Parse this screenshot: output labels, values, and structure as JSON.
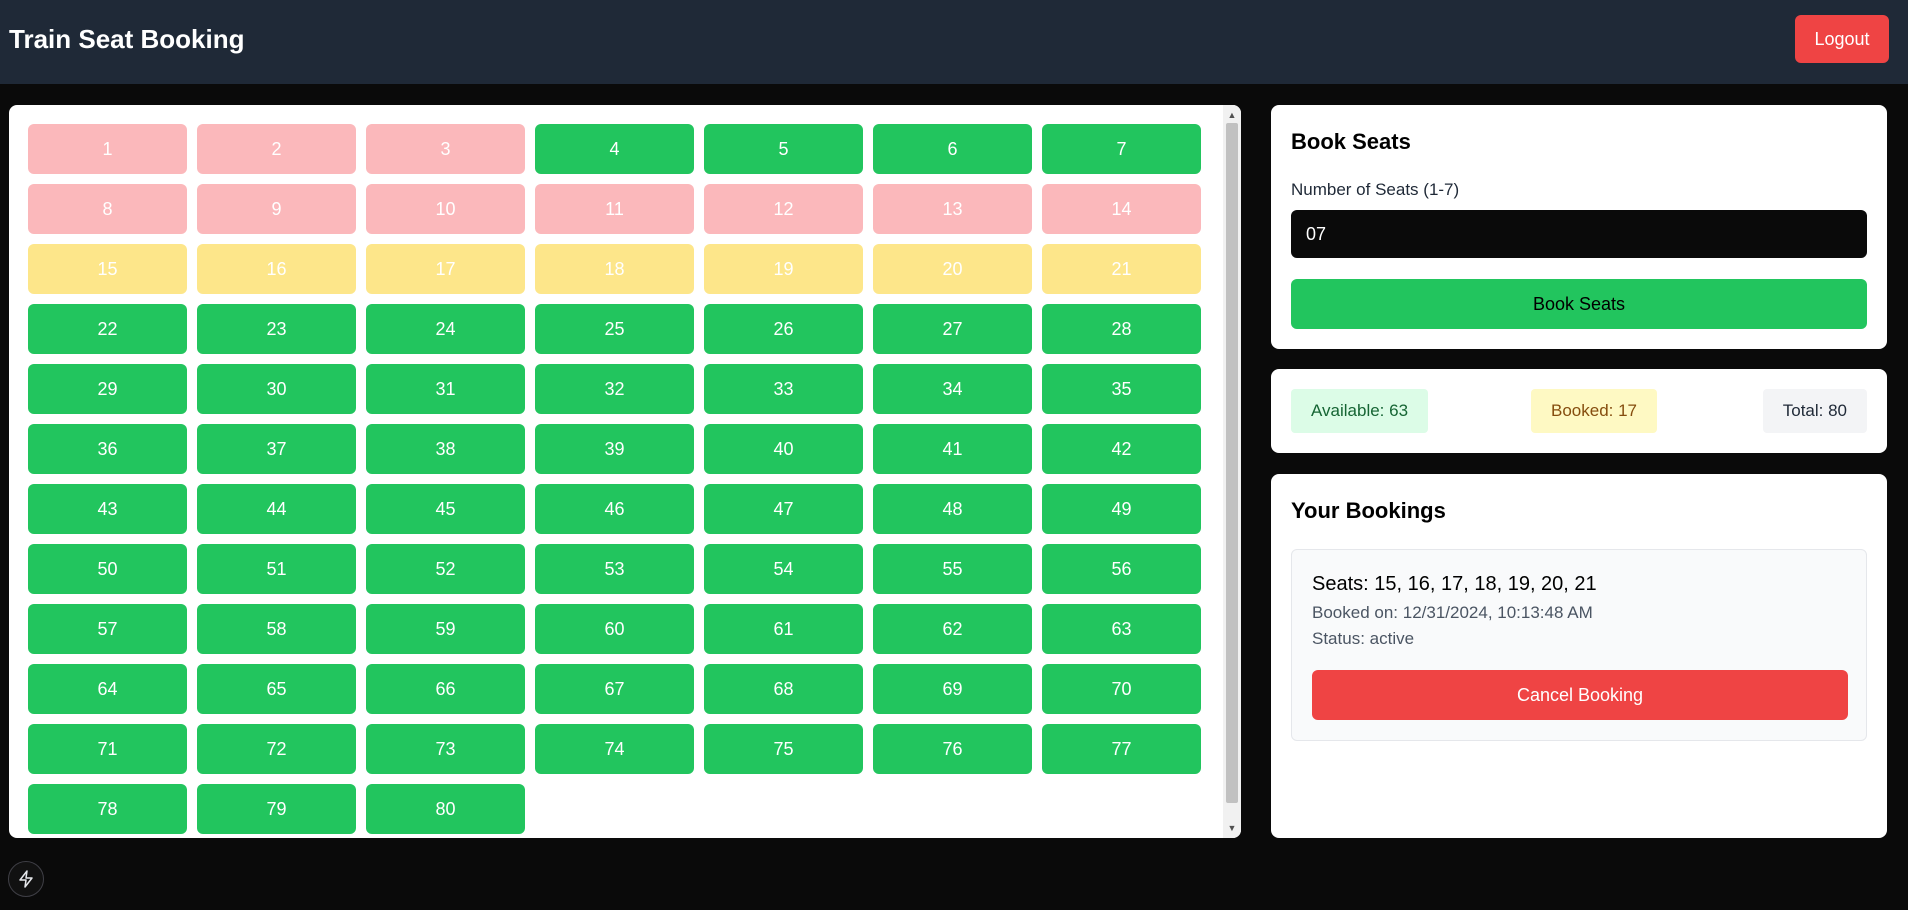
{
  "header": {
    "title": "Train Seat Booking",
    "logout_label": "Logout"
  },
  "seats": {
    "total": 80,
    "columns": 7,
    "booked_by_others": [
      1,
      2,
      3,
      8,
      9,
      10,
      11,
      12,
      13,
      14
    ],
    "booked_by_you": [
      15,
      16,
      17,
      18,
      19,
      20,
      21
    ],
    "colors": {
      "available": "#22c55e",
      "booked_by_others": "#fbb8bb",
      "booked_by_you": "#fde68a"
    }
  },
  "book_form": {
    "title": "Book Seats",
    "label": "Number of Seats (1-7)",
    "value": "07",
    "button_label": "Book Seats"
  },
  "stats": {
    "available": "Available: 63",
    "booked": "Booked: 17",
    "total": "Total: 80"
  },
  "bookings": {
    "title": "Your Bookings",
    "items": [
      {
        "seats": "Seats: 15, 16, 17, 18, 19, 20, 21",
        "booked_on": "Booked on: 12/31/2024, 10:13:48 AM",
        "status": "Status: active",
        "cancel_label": "Cancel Booking"
      }
    ]
  },
  "icons": {
    "floating_button": "lightning-bolt-icon",
    "scroll_up": "triangle-up-icon",
    "scroll_down": "triangle-down-icon"
  }
}
